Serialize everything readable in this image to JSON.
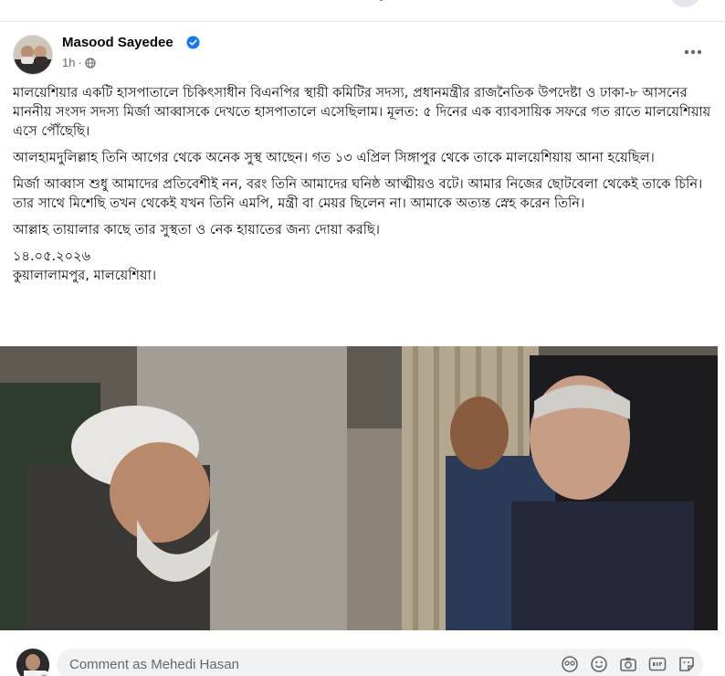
{
  "post": {
    "author": "Masood Sayedee",
    "time": "1h",
    "paragraphs": [
      "মালয়েশিয়ার একটি হাসপাতালে চিকিৎসাধীন বিএনপির স্থায়ী কমিটির সদস্য, প্রধানমন্ত্রীর রাজনৈতিক উপদেষ্টা ও ঢাকা-৮ আসনের মাননীয় সংসদ সদস্য মির্জা আব্বাসকে দেখতে হাসপাতালে এসেছিলাম। মূলত: ৫ দিনের এক ব্যাবসায়িক সফরে গত রাতে মালয়েশিয়ায় এসে পৌঁছেছি।",
      "আলহামদুলিল্লাহ তিনি আগের থেকে অনেক সুস্থ আছেন। গত ১৩ এপ্রিল সিঙ্গাপুর থেকে তাকে মালয়েশিয়ায় আনা হয়েছিল।",
      "মির্জা আব্বাস শুধু আমাদের প্রতিবেশীই নন, বরং তিনি আমাদের ঘনিষ্ঠ আত্মীয়ও বটে। আমার নিজের ছোটবেলা থেকেই তাকে চিনি। তার সাথে মিশেছি তখন থেকেই যখন তিনি এমপি, মন্ত্রী বা মেয়র ছিলেন না। আমাকে অত্যন্ত স্নেহ করেন তিনি।",
      "আল্লাহ তায়ালার কাছে তার সুস্থতা ও নেক হায়াতের জন্য দোয়া করছি।"
    ],
    "date": "১৪.০৫.২০২৬",
    "location": "কুয়ালালামপুর, মালয়েশিয়া।"
  },
  "comment": {
    "placeholder": "Comment as Mehedi Hasan"
  },
  "icons": {
    "verified": "verified-badge-icon",
    "globe": "globe-icon",
    "more": "more-options-icon",
    "comment_tools": [
      "avatar-sticker-icon",
      "emoji-icon",
      "camera-icon",
      "gif-icon",
      "sticker-icon"
    ]
  },
  "colors": {
    "accent": "#1877f2",
    "muted_text": "#65676b",
    "input_bg": "#f0f2f5"
  }
}
